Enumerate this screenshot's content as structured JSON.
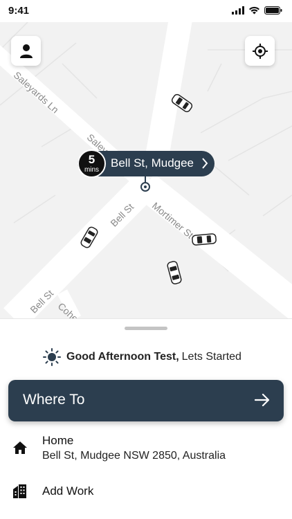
{
  "status_bar": {
    "time": "9:41",
    "icons": [
      "signal-icon",
      "wifi-icon",
      "battery-icon"
    ]
  },
  "map": {
    "street_labels": [
      "Saleyards Ln",
      "Saley",
      "Bell St",
      "Mortimer St",
      "Bell St",
      "Cohen"
    ],
    "eta": {
      "minutes": "5",
      "unit": "mins",
      "location": "Bell St, Mudgee"
    },
    "buttons": {
      "profile_icon": "person-icon",
      "locate_icon": "crosshair-icon"
    },
    "car_count": 4
  },
  "sheet": {
    "greeting_bold": "Good Afternoon Test,",
    "greeting_rest": "Lets Started",
    "greeting_icon": "sun-icon",
    "where_to_label": "Where To",
    "places": [
      {
        "icon": "home-icon",
        "title": "Home",
        "subtitle": "Bell St, Mudgee NSW 2850, Australia"
      },
      {
        "icon": "building-icon",
        "title": "Add Work",
        "subtitle": ""
      }
    ]
  },
  "colors": {
    "primary": "#2c3e4f",
    "map_bg": "#f2f2f2",
    "road": "#ffffff"
  }
}
